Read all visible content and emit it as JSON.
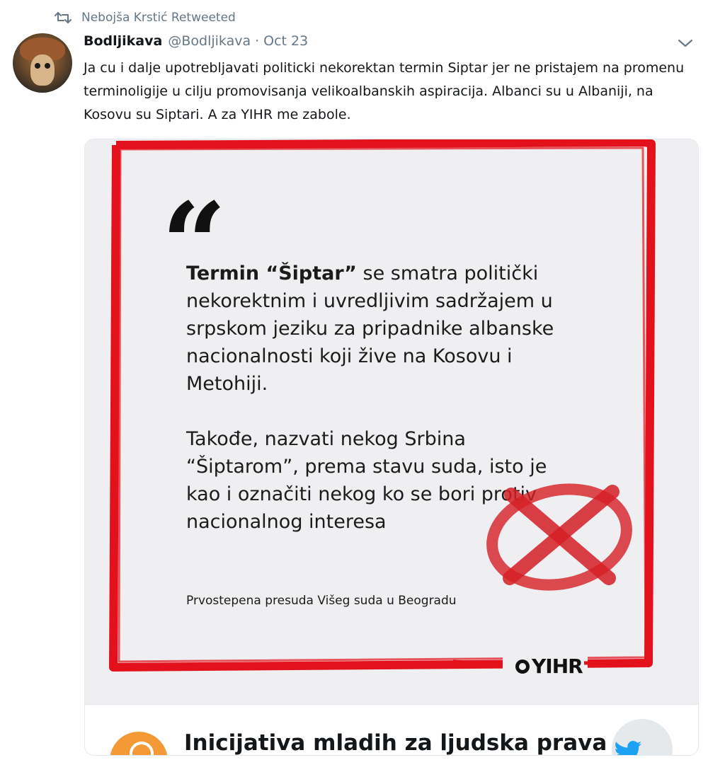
{
  "retweet": {
    "icon": "retweet-icon",
    "text": "Nebojša Krstić Retweeted"
  },
  "author": {
    "name": "Bodljikava",
    "handle": "@Bodljikava",
    "separator": "·",
    "date": "Oct 23"
  },
  "tweet": {
    "text": "Ja cu i dalje upotrebljavati politicki nekorektan termin Siptar jer ne pristajem na promenu terminoligije u cilju promovisanja velikoalbanskih aspiracija. Albanci su u Albaniji, na Kosovu su Siptari. A za YIHR me zabole."
  },
  "card": {
    "image": {
      "quote_mark": "“",
      "quote_bold": "Termin “Šiptar”",
      "quote_rest": " se smatra politički nekorektnim i uvredljivim sadržajem u srpskom jeziku za pripadnike albanske nacionalnosti koji žive na Kosovu i Metohiji.",
      "quote_para2": "Takođe, nazvati nekog Srbina “Šiptarom”, prema stavu suda, isto je kao i označiti nekog ko se bori protiv nacionalnog interesa",
      "source": "Prvostepena presuda Višeg suda u Beogradu",
      "logo_text": "YIHR",
      "frame_color": "#e3111b",
      "cross_color": "#d61f26"
    },
    "footer": {
      "title": "Inicijativa mladih za ljudska prava",
      "logo_color": "#f39a36",
      "badge_icon": "twitter-bird-icon",
      "badge_color": "#1da1f2"
    }
  },
  "colors": {
    "accent": "#1da1f2",
    "muted": "#657786",
    "text": "#14171a"
  }
}
